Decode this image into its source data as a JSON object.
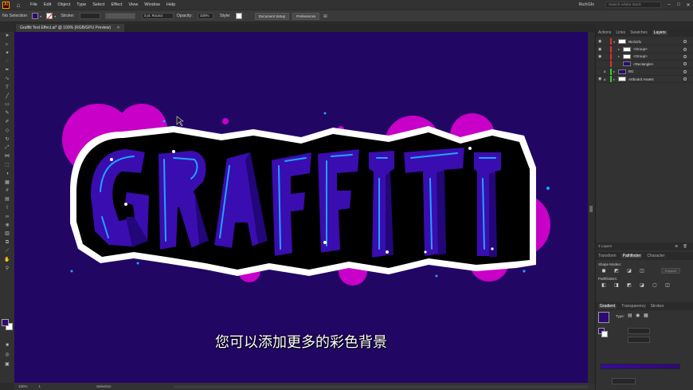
{
  "app": {
    "logo": "Ai",
    "home_icon": "home-icon"
  },
  "menu": [
    "File",
    "Edit",
    "Object",
    "Type",
    "Select",
    "Effect",
    "View",
    "Window",
    "Help"
  ],
  "titlebar": {
    "user": "RichGfx",
    "search_placeholder": "Search Adobe Stock"
  },
  "controlbar": {
    "selection_label": "No Selection",
    "stroke_label": "Stroke:",
    "brush_value": "3 pt. Round",
    "opacity_label": "Opacity:",
    "opacity_value": "100%",
    "style_label": "Style:",
    "doc_setup": "Document Setup",
    "preferences": "Preferences"
  },
  "document": {
    "tab_title": "Graffiti Text Effect.ai* @ 100% (RGB/GPU Preview)"
  },
  "artwork": {
    "colors": {
      "background": "#220664",
      "magenta": "#c800c8",
      "letter_fill": "#3a0db0",
      "letter_highlight": "#1fa3ff",
      "outline": "#000000"
    }
  },
  "subtitle": "您可以添加更多的彩色背景",
  "status": {
    "zoom": "100%",
    "artboard": "1",
    "tool": "Selection"
  },
  "panels": {
    "tabs": [
      "Actions",
      "Links",
      "Swatches",
      "Layers"
    ],
    "layers": [
      {
        "name": "RichGfx",
        "color": "#e03030",
        "thumb": "white"
      },
      {
        "name": "<Group>",
        "color": "#e03030",
        "thumb": "white"
      },
      {
        "name": "<Group>",
        "color": "#e03030",
        "thumb": "white"
      },
      {
        "name": "<Rectangle>",
        "color": "#e03030",
        "thumb": "purple"
      },
      {
        "name": "BG",
        "color": "#30d030",
        "thumb": "purple"
      },
      {
        "name": "Artboard Assets",
        "color": "#30d030",
        "thumb": "white"
      }
    ],
    "layers_count": "3 Layers",
    "pathfinder_tabs": [
      "Transform",
      "Pathfinder",
      "Character"
    ],
    "shape_modes": "Shape Modes:",
    "pathfinders": "Pathfinders:",
    "expand": "Expand",
    "gradient_tabs": [
      "Gradient",
      "Transparency",
      "Strokes"
    ],
    "gradient_type": "Type:"
  }
}
